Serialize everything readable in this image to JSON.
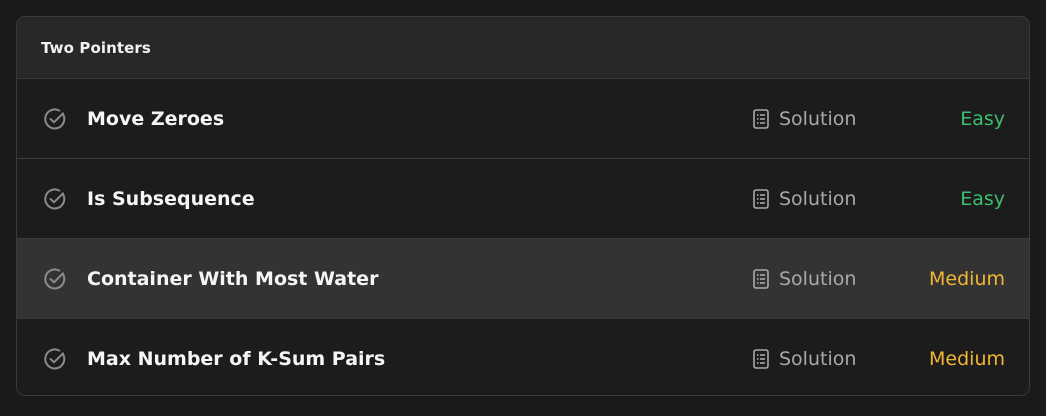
{
  "section": {
    "title": "Two Pointers"
  },
  "problems": [
    {
      "title": "Move Zeroes",
      "solution_label": "Solution",
      "difficulty": "Easy"
    },
    {
      "title": "Is Subsequence",
      "solution_label": "Solution",
      "difficulty": "Easy"
    },
    {
      "title": "Container With Most Water",
      "solution_label": "Solution",
      "difficulty": "Medium"
    },
    {
      "title": "Max Number of K-Sum Pairs",
      "solution_label": "Solution",
      "difficulty": "Medium"
    }
  ],
  "icons": {
    "status": "check-circle-icon",
    "solution": "document-icon"
  },
  "colors": {
    "easy": "#3cbf6e",
    "medium": "#f2b636",
    "background": "#1a1a1a",
    "header": "#282828",
    "row_hover": "#333333"
  }
}
